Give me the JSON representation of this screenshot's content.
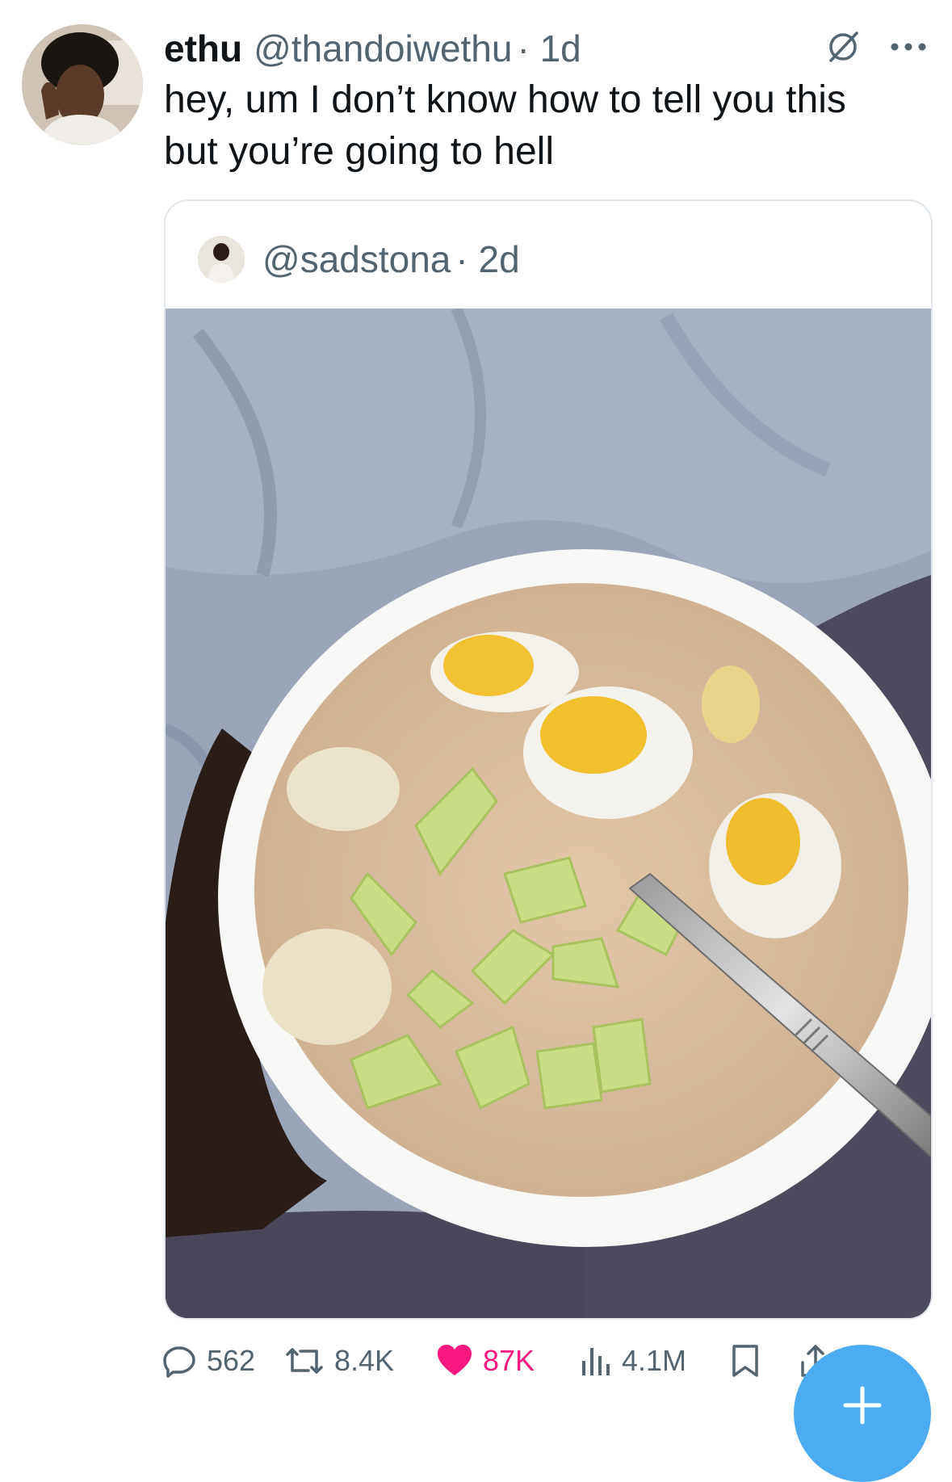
{
  "tweet": {
    "display_name": "ethu",
    "handle": "@thandoiwethu",
    "time": "· 1d",
    "text": "hey, um I don’t know how to tell you this\nbut you’re  going to hell"
  },
  "quoted": {
    "handle": "@sadstona",
    "time": "· 2d"
  },
  "actions": {
    "replies": "562",
    "reposts": "8.4K",
    "likes": "87K",
    "views": "4.1M"
  },
  "icons": {
    "top": [
      "grok-icon",
      "more-icon"
    ],
    "bottom": [
      "reply-icon",
      "repost-icon",
      "like-icon",
      "views-icon",
      "bookmark-icon",
      "share-icon",
      "compose-plus-icon"
    ]
  },
  "colors": {
    "like": "#f91880",
    "muted": "#536471",
    "fab": "#4cacf2"
  }
}
